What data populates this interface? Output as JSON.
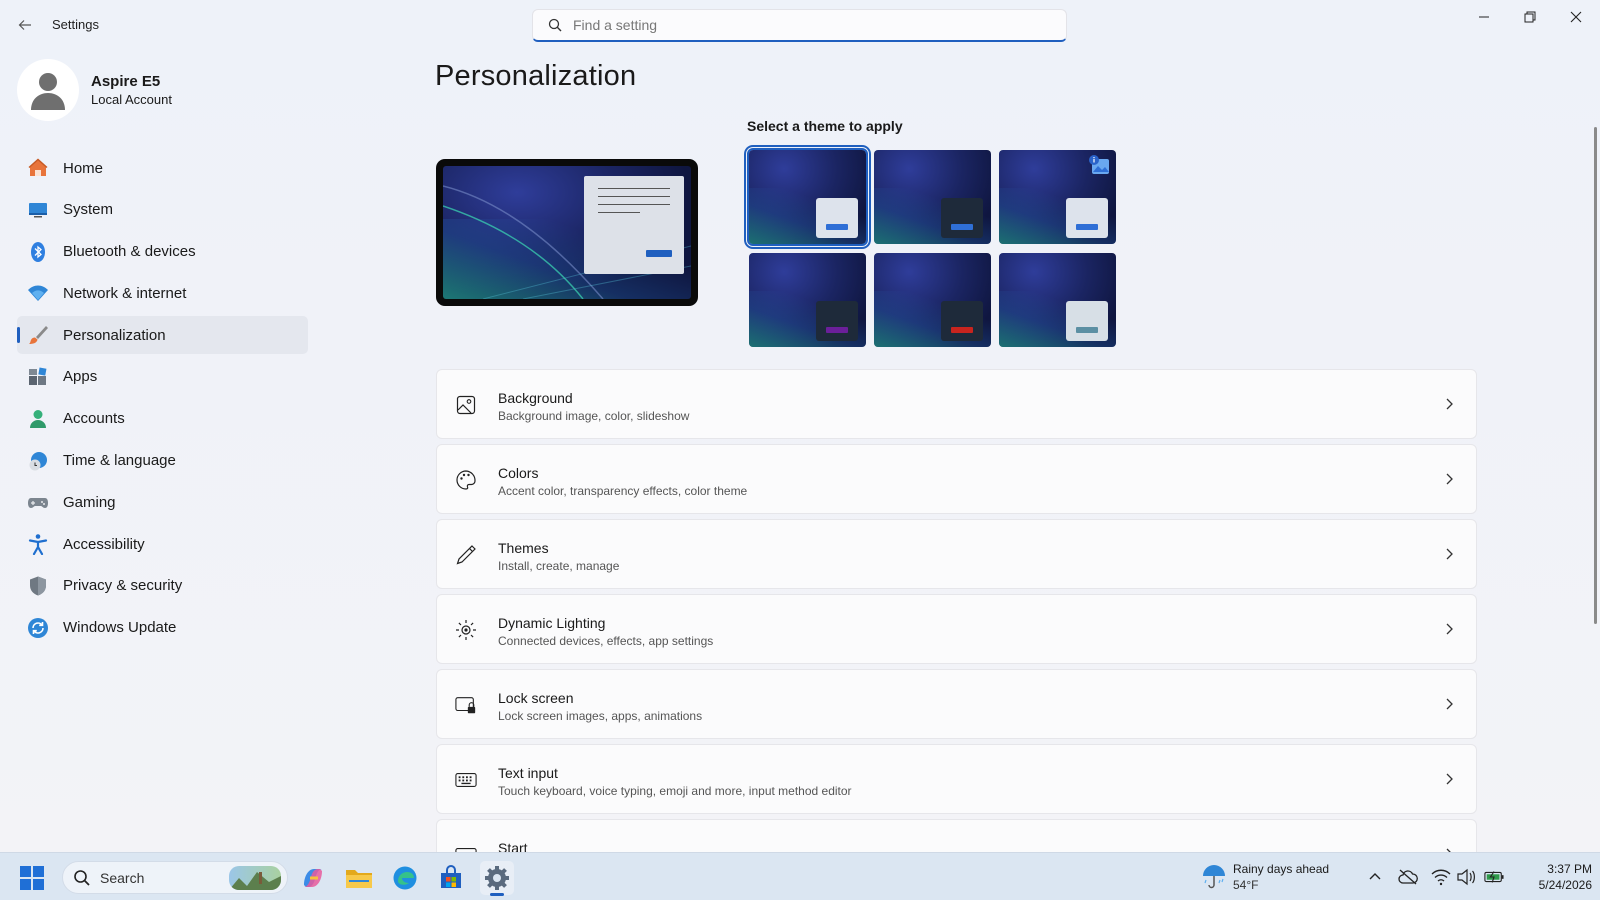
{
  "app": {
    "title": "Settings"
  },
  "search": {
    "placeholder": "Find a setting"
  },
  "user": {
    "name": "Aspire E5",
    "account_type": "Local Account"
  },
  "nav": {
    "items": [
      {
        "label": "Home",
        "icon": "home-icon"
      },
      {
        "label": "System",
        "icon": "system-icon"
      },
      {
        "label": "Bluetooth & devices",
        "icon": "bluetooth-icon"
      },
      {
        "label": "Network & internet",
        "icon": "wifi-icon"
      },
      {
        "label": "Personalization",
        "icon": "brush-icon",
        "active": true
      },
      {
        "label": "Apps",
        "icon": "apps-icon"
      },
      {
        "label": "Accounts",
        "icon": "accounts-icon"
      },
      {
        "label": "Time & language",
        "icon": "clock-icon"
      },
      {
        "label": "Gaming",
        "icon": "gamepad-icon"
      },
      {
        "label": "Accessibility",
        "icon": "accessibility-icon"
      },
      {
        "label": "Privacy & security",
        "icon": "shield-icon"
      },
      {
        "label": "Windows Update",
        "icon": "update-icon"
      }
    ]
  },
  "page": {
    "title": "Personalization",
    "theme_heading": "Select a theme to apply",
    "themes": [
      {
        "window_color": "#dde3ec",
        "accent": "#2f6fd6",
        "selected": true
      },
      {
        "window_color": "#1e2a3a",
        "accent": "#2f6fd6"
      },
      {
        "window_color": "#dde3ec",
        "accent": "#2f6fd6",
        "spotlight": true
      },
      {
        "window_color": "#1e2a3a",
        "accent": "#6b1f9a"
      },
      {
        "window_color": "#1e2a3a",
        "accent": "#c8241e"
      },
      {
        "window_color": "#d7dfe6",
        "accent": "#5b8fa3"
      }
    ]
  },
  "cards": [
    {
      "title": "Background",
      "subtitle": "Background image, color, slideshow",
      "icon": "image-icon"
    },
    {
      "title": "Colors",
      "subtitle": "Accent color, transparency effects, color theme",
      "icon": "palette-icon"
    },
    {
      "title": "Themes",
      "subtitle": "Install, create, manage",
      "icon": "pen-icon"
    },
    {
      "title": "Dynamic Lighting",
      "subtitle": "Connected devices, effects, app settings",
      "icon": "lighting-icon"
    },
    {
      "title": "Lock screen",
      "subtitle": "Lock screen images, apps, animations",
      "icon": "lock-screen-icon"
    },
    {
      "title": "Text input",
      "subtitle": "Touch keyboard, voice typing, emoji and more, input method editor",
      "icon": "keyboard-icon"
    },
    {
      "title": "Start",
      "subtitle": "",
      "icon": "start-icon"
    }
  ],
  "taskbar": {
    "search_label": "Search",
    "weather_title": "Rainy days ahead",
    "weather_temp": "54°F",
    "time": "3:37 PM",
    "date": "5/24/2026"
  },
  "colors": {
    "accent": "#1f5fbf"
  }
}
